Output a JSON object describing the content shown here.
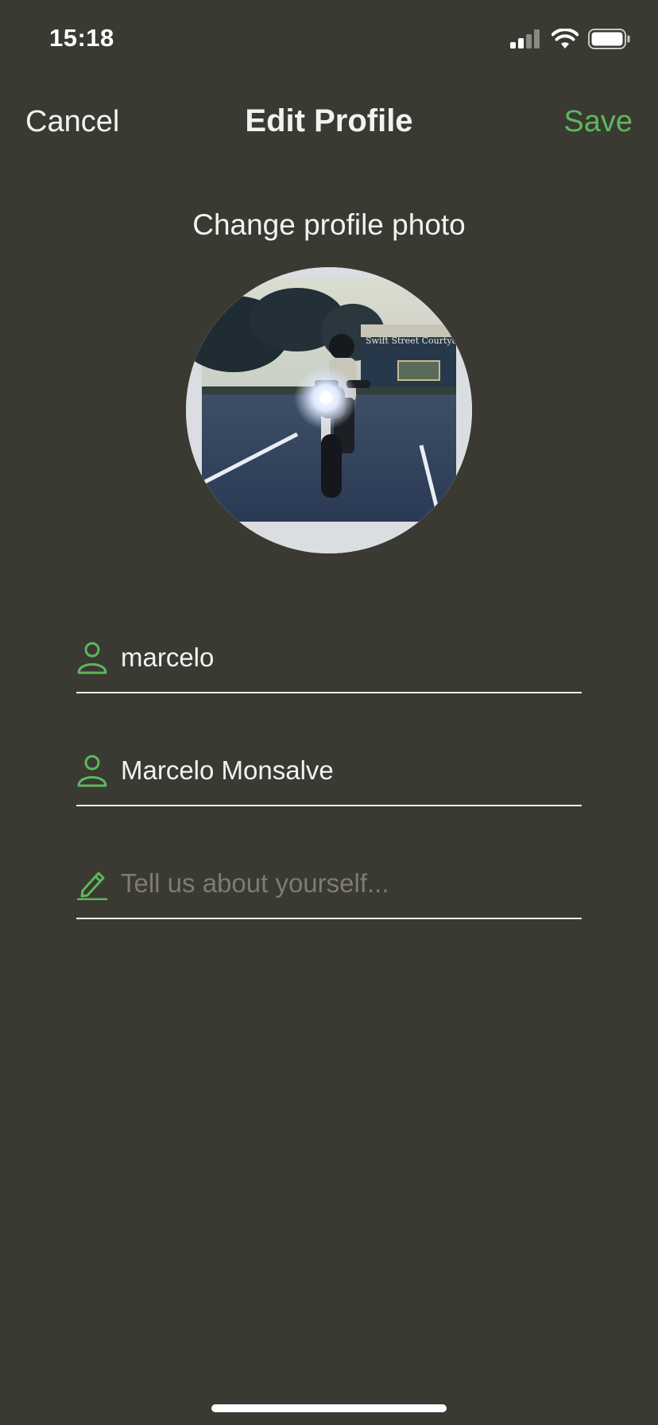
{
  "status_bar": {
    "time": "15:18",
    "signal_icon": "cellular-signal-icon",
    "wifi_icon": "wifi-icon",
    "battery_icon": "battery-icon"
  },
  "nav": {
    "cancel_label": "Cancel",
    "title": "Edit Profile",
    "save_label": "Save"
  },
  "profile_photo": {
    "change_label": "Change profile photo",
    "photo_caption": "Swift Street Courtya"
  },
  "form": {
    "username": {
      "value": "marcelo",
      "icon": "person-icon"
    },
    "full_name": {
      "value": "Marcelo Monsalve",
      "icon": "person-icon"
    },
    "bio": {
      "value": "",
      "placeholder": "Tell us about yourself...",
      "icon": "pencil-icon"
    }
  },
  "colors": {
    "background": "#3a3932",
    "accent": "#5cb85c",
    "text": "#f2f2f2",
    "placeholder": "#7d7c74"
  }
}
